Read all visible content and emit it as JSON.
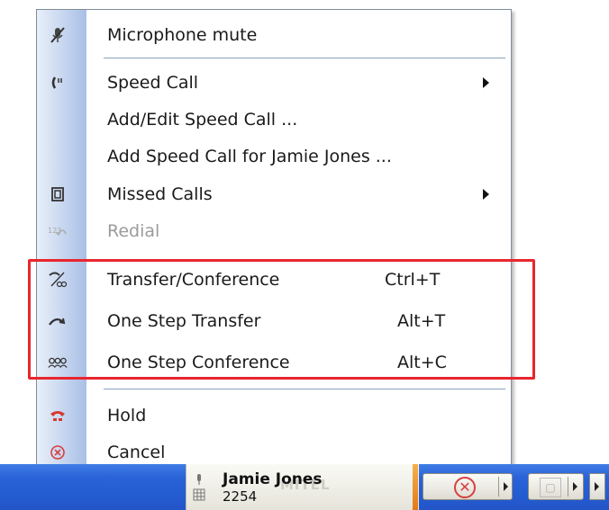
{
  "menu": {
    "items": [
      {
        "label": "Microphone mute",
        "icon": "microphone-mute-icon",
        "glyph": "🎤"
      },
      {
        "label": "Speed Call",
        "icon": "speed-call-icon",
        "glyph": "☏"
      },
      {
        "label": "Add/Edit Speed Call ..."
      },
      {
        "label": "Add Speed Call for Jamie Jones ..."
      },
      {
        "label": "Missed Calls",
        "icon": "missed-calls-icon",
        "glyph": "▣"
      },
      {
        "label": "Redial",
        "icon": "redial-icon",
        "glyph": "↶"
      },
      {
        "label": "Transfer/Conference",
        "shortcut": "Ctrl+T",
        "icon": "transfer-conference-icon",
        "glyph": "⤳"
      },
      {
        "label": "One Step Transfer",
        "shortcut": "Alt+T",
        "icon": "one-step-transfer-icon",
        "glyph": "↷"
      },
      {
        "label": "One Step Conference",
        "shortcut": "Alt+C",
        "icon": "one-step-conference-icon",
        "glyph": "☺"
      },
      {
        "label": "Hold",
        "icon": "hold-icon",
        "glyph": "☎"
      },
      {
        "label": "Cancel",
        "icon": "cancel-icon",
        "glyph": "⊗"
      }
    ]
  },
  "taskbar": {
    "contact_name": "Jamie Jones",
    "extension": "2254",
    "watermark": "MITEL"
  },
  "colors": {
    "highlight_border": "#e8262e",
    "menu_gutter": "#c3d3ee",
    "taskbar_blue": "#235bd1",
    "disabled_text": "#9b9b9b"
  }
}
